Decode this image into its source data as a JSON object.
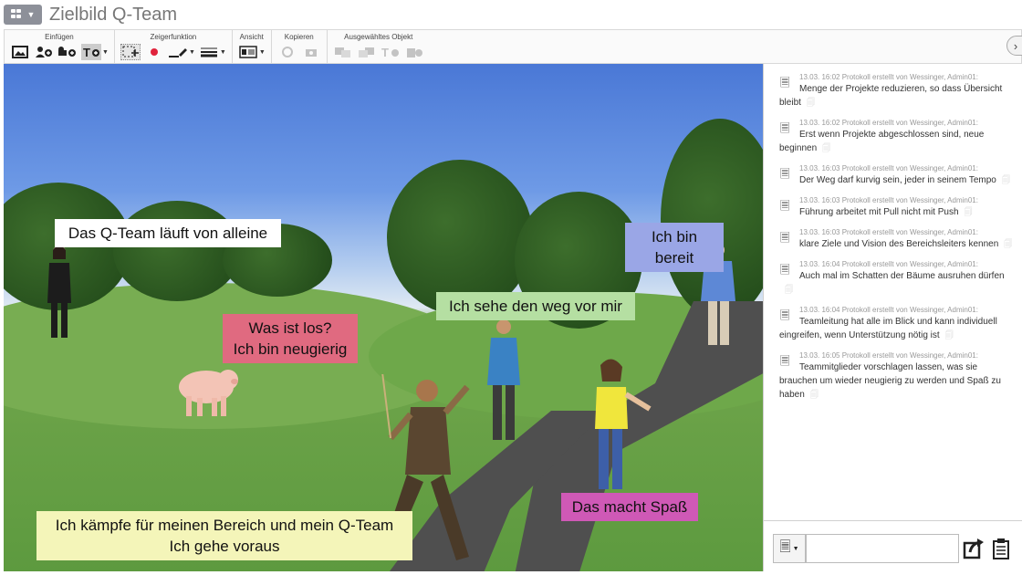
{
  "title": "Zielbild Q-Team",
  "toolbar": {
    "groups": [
      {
        "label": "Einfügen"
      },
      {
        "label": "Zeigerfunktion"
      },
      {
        "label": "Ansicht"
      },
      {
        "label": "Kopieren"
      },
      {
        "label": "Ausgewähltes Objekt"
      }
    ]
  },
  "canvas": {
    "bubbles": [
      {
        "text": "Das Q-Team läuft von alleine",
        "color": "#ffffff"
      },
      {
        "text": "Was ist los?\nIch bin neugierig",
        "color": "#e06a80"
      },
      {
        "text": "Ich sehe den weg vor mir",
        "color": "#b5dfa2"
      },
      {
        "text": "Ich bin bereit",
        "color": "#9aa6e6"
      },
      {
        "text": "Das macht Spaß",
        "color": "#cf59b6"
      },
      {
        "text": "Ich kämpfe für meinen Bereich und mein Q-Team\nIch gehe voraus",
        "color": "#f4f5b9"
      }
    ]
  },
  "protocol": {
    "entries": [
      {
        "meta": "13.03. 16:02 Protokoll erstellt von Wessinger, Admin01:",
        "text": "Menge der Projekte reduzieren, so dass Übersicht bleibt"
      },
      {
        "meta": "13.03. 16:02 Protokoll erstellt von Wessinger, Admin01:",
        "text": "Erst wenn Projekte abgeschlossen sind, neue beginnen"
      },
      {
        "meta": "13.03. 16:03 Protokoll erstellt von Wessinger, Admin01:",
        "text": "Der Weg darf kurvig sein, jeder in seinem Tempo"
      },
      {
        "meta": "13.03. 16:03 Protokoll erstellt von Wessinger, Admin01:",
        "text": "Führung arbeitet mit Pull nicht mit Push"
      },
      {
        "meta": "13.03. 16:03 Protokoll erstellt von Wessinger, Admin01:",
        "text": "klare Ziele und Vision des Bereichsleiters kennen"
      },
      {
        "meta": "13.03. 16:04 Protokoll erstellt von Wessinger, Admin01:",
        "text": "Auch mal im Schatten der Bäume ausruhen dürfen"
      },
      {
        "meta": "13.03. 16:04 Protokoll erstellt von Wessinger, Admin01:",
        "text": "Teamleitung hat alle im Blick und kann individuell eingreifen, wenn Unterstützung nötig ist"
      },
      {
        "meta": "13.03. 16:05 Protokoll erstellt von Wessinger, Admin01:",
        "text": "Teammitglieder vorschlagen lassen, was sie brauchen um wieder neugierig zu werden und Spaß zu haben"
      }
    ]
  },
  "input": {
    "value": "",
    "placeholder": ""
  }
}
